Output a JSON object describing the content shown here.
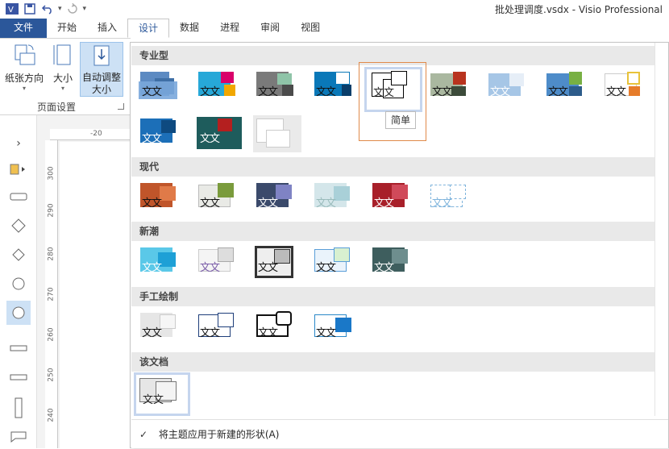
{
  "window": {
    "title": "批处理调度.vsdx - Visio Professional"
  },
  "qat": {
    "undo_icon": "undo-icon",
    "redo_icon": "redo-icon",
    "save_icon": "save-icon",
    "customize": "▾"
  },
  "tabs": [
    {
      "label": "文件"
    },
    {
      "label": "开始"
    },
    {
      "label": "插入"
    },
    {
      "label": "设计"
    },
    {
      "label": "数据"
    },
    {
      "label": "进程"
    },
    {
      "label": "审阅"
    },
    {
      "label": "视图"
    }
  ],
  "ribbon": {
    "orientation_label": "纸张方向",
    "size_label": "大小",
    "autosize_label": "自动调整\n大小",
    "group_label": "页面设置"
  },
  "rulers": {
    "h": [
      "-20"
    ],
    "v": [
      "300",
      "290",
      "280",
      "270",
      "260",
      "250",
      "240"
    ]
  },
  "gallery": {
    "sections": [
      {
        "label": "专业型"
      },
      {
        "label": "现代"
      },
      {
        "label": "新潮"
      },
      {
        "label": "手工绘制"
      },
      {
        "label": "该文档"
      }
    ],
    "thumb_text": "文文",
    "tooltip": "简单",
    "footer": "将主题应用于新建的形状(A)",
    "footer_check": "✓"
  },
  "colors": {
    "accent": "#2b579a",
    "highlight": "#e08a4a"
  }
}
